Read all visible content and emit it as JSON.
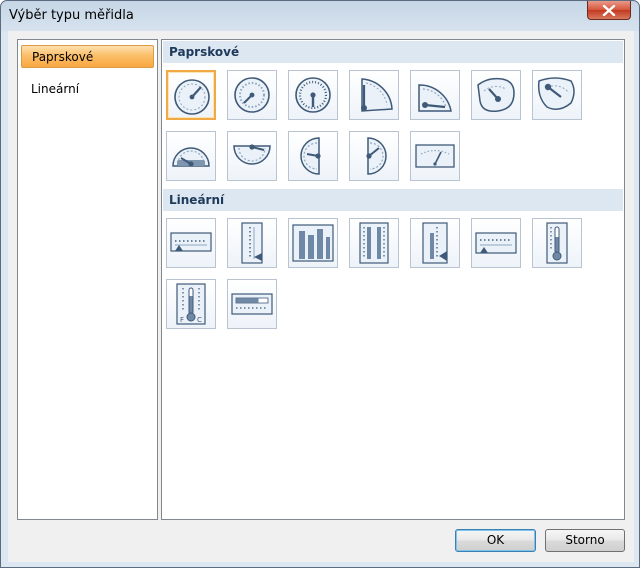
{
  "window": {
    "title": "Výběr typu měřidla",
    "close_icon": "close-icon"
  },
  "nav": {
    "items": [
      {
        "label": "Paprskové",
        "selected": true
      },
      {
        "label": "Lineární",
        "selected": false
      }
    ]
  },
  "sections": [
    {
      "title": "Paprskové"
    },
    {
      "title": "Lineární"
    }
  ],
  "gallery": {
    "radial": [
      "radial-gauge-1-icon",
      "radial-gauge-2-icon",
      "radial-gauge-3-icon",
      "radial-quarter-gauge-icon",
      "radial-quarter-gauge-2-icon",
      "radial-gauge-free-icon",
      "radial-gauge-free-2-icon",
      "radial-half-gauge-icon",
      "radial-half-gauge-2-icon",
      "radial-half-gauge-vertical-icon",
      "radial-half-gauge-vertical-2-icon",
      "meter-gauge-icon"
    ],
    "linear": [
      "linear-horizontal-gauge-icon",
      "linear-vertical-gauge-icon",
      "linear-bar-gauge-icon",
      "linear-multi-vertical-gauge-icon",
      "linear-vertical-gauge-2-icon",
      "linear-horizontal-gauge-2-icon",
      "thermometer-gauge-icon",
      "thermometer-fc-gauge-icon",
      "linear-horizontal-bar-gauge-icon"
    ],
    "selected": "radial-gauge-1-icon",
    "thermometer_scale": {
      "left": "F",
      "right": "C"
    }
  },
  "buttons": {
    "ok": "OK",
    "cancel": "Storno"
  },
  "colors": {
    "selection": "#f9a640",
    "header": "#dde7f1",
    "icon_stroke": "#3f5a78"
  }
}
